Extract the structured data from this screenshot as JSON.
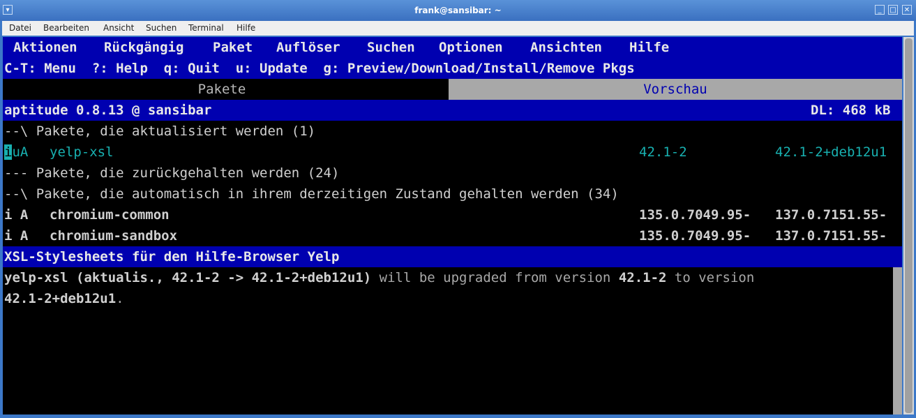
{
  "window": {
    "title": "frank@sansibar: ~",
    "btn_menu": "▾",
    "btn_min": "_",
    "btn_max": "□",
    "btn_close": "✕"
  },
  "menubar": [
    "Datei",
    "Bearbeiten",
    "Ansicht",
    "Suchen",
    "Terminal",
    "Hilfe"
  ],
  "aptitude": {
    "menu": [
      "Aktionen",
      "Rückgängig",
      "Paket",
      "Auflöser",
      "Suchen",
      "Optionen",
      "Ansichten",
      "Hilfe"
    ],
    "help_line": "C-T: Menu  ?: Help  q: Quit  u: Update  g: Preview/Download/Install/Remove Pkgs",
    "tabs": [
      "Pakete",
      "Vorschau"
    ],
    "status": {
      "left": "aptitude 0.8.13 @ sansibar",
      "right": "DL: 468 kB"
    },
    "lines": [
      {
        "text": "--\\ Pakete, die aktualisiert werden (1)"
      },
      {
        "flags": "iuA",
        "name": "yelp-xsl",
        "cur": "42.1-2",
        "new": "42.1-2+deb12u1"
      },
      {
        "text": "--- Pakete, die zurückgehalten werden (24)"
      },
      {
        "text": "--\\ Pakete, die automatisch in ihrem derzeitigen Zustand gehalten werden (34)"
      },
      {
        "flags": "i A",
        "name": "chromium-common",
        "cur": "135.0.7049.95-",
        "new": "137.0.7151.55-"
      },
      {
        "flags": "i A",
        "name": "chromium-sandbox",
        "cur": "135.0.7049.95-",
        "new": "137.0.7151.55-"
      }
    ],
    "description_title": "XSL-Stylesheets für den Hilfe-Browser Yelp",
    "detail": {
      "pkg": "yelp-xsl (aktualis., 42.1-2 -> 42.1-2+deb12u1)",
      "t1": " will be upgraded from version ",
      "v1": "42.1-2",
      "t2": " to version",
      "v2": "42.1-2+deb12u1",
      "t3": "."
    }
  }
}
